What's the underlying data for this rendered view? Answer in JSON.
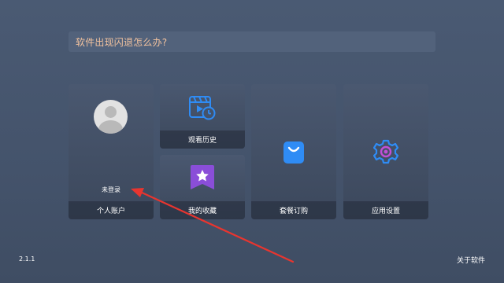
{
  "faq": {
    "text": "软件出现闪退怎么办?"
  },
  "account_card": {
    "status": "未登录",
    "label": "个人账户"
  },
  "history_card": {
    "label": "观看历史",
    "icon": "film-clock-icon"
  },
  "favorites_card": {
    "label": "我的收藏",
    "icon": "bookmark-star-icon"
  },
  "plans_card": {
    "label": "套餐订购",
    "icon": "shopping-bag-icon"
  },
  "settings_card": {
    "label": "应用设置",
    "icon": "gear-icon"
  },
  "footer": {
    "version": "2.1.1",
    "about": "关于软件"
  },
  "colors": {
    "background": "#475670",
    "faq_text": "#f3c39f",
    "accent_blue": "#2f8cf5",
    "accent_purple": "#8a4ed8",
    "annotation_red": "#e8352f"
  }
}
